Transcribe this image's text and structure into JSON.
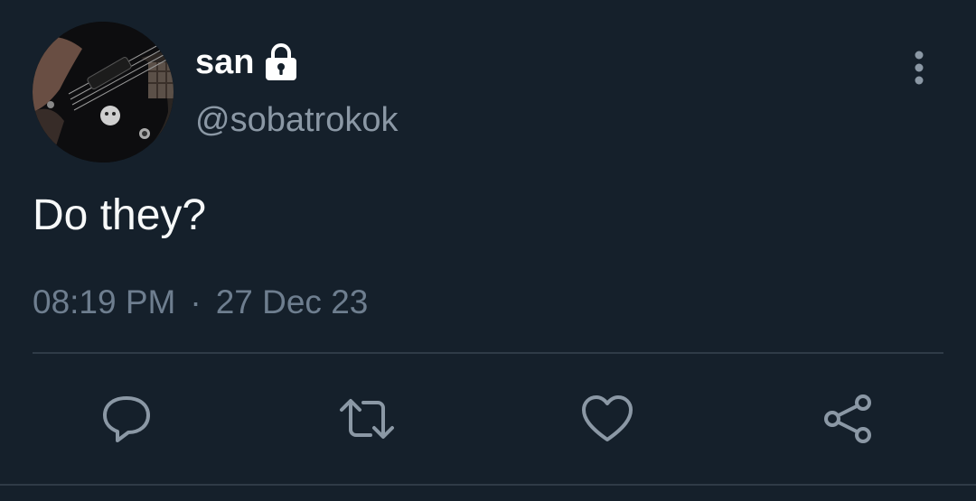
{
  "author": {
    "display_name": "san",
    "handle": "@sobatrokok",
    "protected": true
  },
  "tweet": {
    "text": "Do they?",
    "time": "08:19 PM",
    "separator": "·",
    "date": "27 Dec 23"
  },
  "actions": [
    "reply-icon",
    "retweet-icon",
    "like-icon",
    "share-icon"
  ],
  "colors": {
    "background": "#15202b",
    "primary_text": "#ffffff",
    "secondary_text": "#8b98a5",
    "icon": "#8b98a5",
    "divider": "#2f3b47"
  }
}
